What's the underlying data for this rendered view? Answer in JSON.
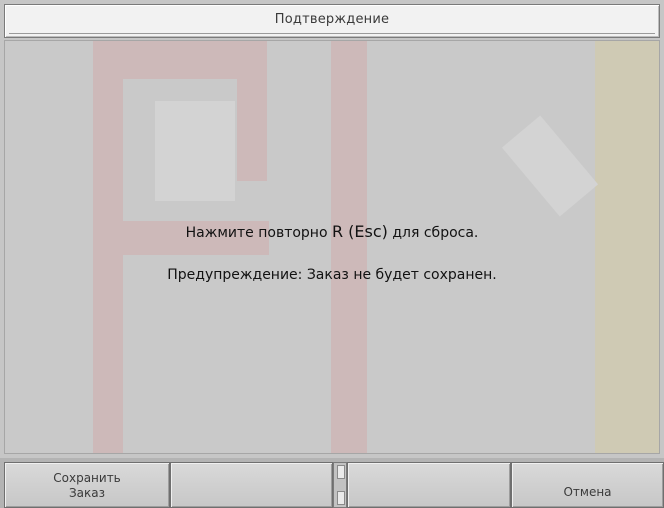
{
  "window": {
    "title": "Подтверждение"
  },
  "message": {
    "line1_prefix": "Нажмите повторно ",
    "line1_key": "R (Esc)",
    "line1_suffix": " для сброса.",
    "line2": "Предупреждение: Заказ не будет сохранен."
  },
  "toolbar": {
    "f1_line1": "Сохранить",
    "f1_line2": "Заказ",
    "f2": "",
    "f3": "",
    "f4": "Отмена"
  },
  "colors": {
    "background": "#c6c6c6",
    "titlebar": "#f2f2f2",
    "watermark_red": "#cdb9b9",
    "watermark_yellow": "#cfcab4"
  }
}
